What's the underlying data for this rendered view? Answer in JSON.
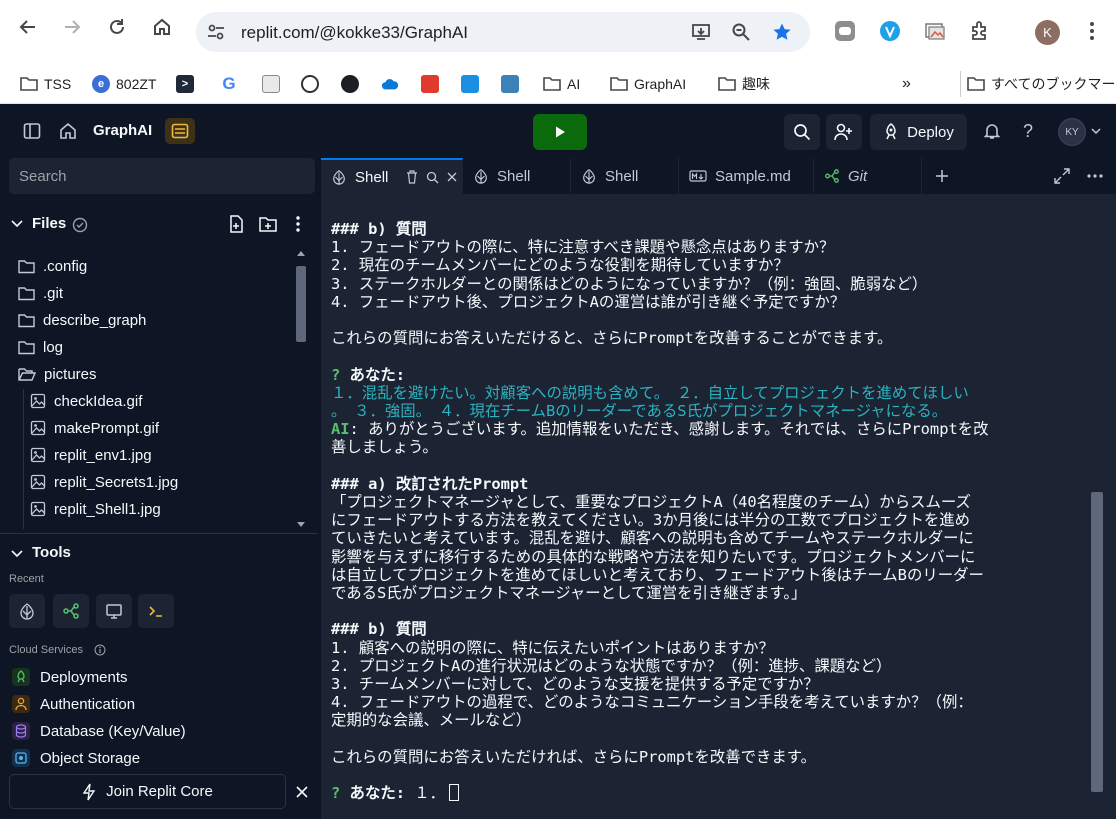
{
  "browser": {
    "url": "replit.com/@kokke33/GraphAI",
    "profile_initial": "K",
    "bookmarks": [
      {
        "label": "TSS",
        "icon": "folder-icon"
      },
      {
        "label": "802ZT",
        "icon": "globe-icon"
      },
      {
        "label": "",
        "icon": "terminal-icon"
      },
      {
        "label": "",
        "icon": "google-icon"
      },
      {
        "label": "",
        "icon": "image-icon"
      },
      {
        "label": "",
        "icon": "circle-icon"
      },
      {
        "label": "",
        "icon": "github-icon"
      },
      {
        "label": "",
        "icon": "cloud-icon"
      },
      {
        "label": "",
        "icon": "cube-icon"
      },
      {
        "label": "",
        "icon": "app-icon"
      },
      {
        "label": "",
        "icon": "list-icon"
      },
      {
        "label": "AI",
        "icon": "folder-icon"
      },
      {
        "label": "GraphAI",
        "icon": "folder-icon"
      },
      {
        "label": "趣味",
        "icon": "folder-icon"
      }
    ],
    "all_bookmarks": "すべてのブックマーク"
  },
  "header": {
    "repl_name": "GraphAI",
    "deploy_label": "Deploy",
    "user_initials": "KY"
  },
  "sidebar": {
    "search_placeholder": "Search",
    "files_title": "Files",
    "tree": [
      {
        "name": ".config",
        "type": "folder",
        "depth": 0
      },
      {
        "name": ".git",
        "type": "folder",
        "depth": 0
      },
      {
        "name": "describe_graph",
        "type": "folder",
        "depth": 0
      },
      {
        "name": "log",
        "type": "folder",
        "depth": 0
      },
      {
        "name": "pictures",
        "type": "folder-open",
        "depth": 0
      },
      {
        "name": "checkIdea.gif",
        "type": "image",
        "depth": 1
      },
      {
        "name": "makePrompt.gif",
        "type": "image",
        "depth": 1
      },
      {
        "name": "replit_env1.jpg",
        "type": "image",
        "depth": 1
      },
      {
        "name": "replit_Secrets1.jpg",
        "type": "image",
        "depth": 1
      },
      {
        "name": "replit_Shell1.jpg",
        "type": "image",
        "depth": 1
      }
    ],
    "tools_title": "Tools",
    "recent_label": "Recent",
    "cloud_label": "Cloud Services",
    "services": [
      {
        "label": "Deployments",
        "icon": "deploy-icon",
        "color": "#58c06b"
      },
      {
        "label": "Authentication",
        "icon": "user-icon",
        "color": "#f0a33a"
      },
      {
        "label": "Database (Key/Value)",
        "icon": "database-icon",
        "color": "#9d7bf0"
      },
      {
        "label": "Object Storage",
        "icon": "storage-icon",
        "color": "#56b3f0"
      }
    ],
    "join_label": "Join Replit Core"
  },
  "tabs": [
    {
      "label": "Shell",
      "icon": "shell-icon",
      "active": true
    },
    {
      "label": "Shell",
      "icon": "shell-icon",
      "active": false
    },
    {
      "label": "Shell",
      "icon": "shell-icon",
      "active": false
    },
    {
      "label": "Sample.md",
      "icon": "markdown-icon",
      "active": false
    },
    {
      "label": "Git",
      "icon": "git-icon",
      "active": false
    }
  ],
  "terminal": {
    "lines": [
      {
        "text": "### b) 質問",
        "style": "bold"
      },
      {
        "text": "1. フェードアウトの際に、特に注意すべき課題や懸念点はありますか？",
        "style": "normal"
      },
      {
        "text": "2. 現在のチームメンバーにどのような役割を期待していますか？",
        "style": "normal"
      },
      {
        "text": "3. ステークホルダーとの関係はどのようになっていますか？（例：強固、脆弱など）",
        "style": "normal"
      },
      {
        "text": "4. フェードアウト後、プロジェクトAの運営は誰が引き継ぐ予定ですか？",
        "style": "normal"
      },
      {
        "text": "",
        "style": "blank"
      },
      {
        "text": "これらの質問にお答えいただけると、さらにPromptを改善することができます。",
        "style": "normal"
      },
      {
        "text": "",
        "style": "blank"
      },
      {
        "prefix": "? ",
        "text": "あなた:",
        "style": "prompt"
      },
      {
        "text": "１．混乱を避けたい。対顧客への説明も含めて。　２．自立してプロジェクトを進めてほしい",
        "style": "teal"
      },
      {
        "text": "。　３．強固。　４．現在チームBのリーダーであるS氏がプロジェクトマネージャになる。",
        "style": "teal"
      },
      {
        "prefix": "AI",
        "text": ": ありがとうございます。追加情報をいただき、感謝します。それでは、さらにPromptを改",
        "style": "ai"
      },
      {
        "text": "善しましょう。",
        "style": "normal"
      },
      {
        "text": "",
        "style": "blank"
      },
      {
        "text": "### a) 改訂されたPrompt",
        "style": "bold"
      },
      {
        "text": "「プロジェクトマネージャとして、重要なプロジェクトA（40名程度のチーム）からスムーズ",
        "style": "normal"
      },
      {
        "text": "にフェードアウトする方法を教えてください。3か月後には半分の工数でプロジェクトを進め",
        "style": "normal"
      },
      {
        "text": "ていきたいと考えています。混乱を避け、顧客への説明も含めてチームやステークホルダーに",
        "style": "normal"
      },
      {
        "text": "影響を与えずに移行するための具体的な戦略や方法を知りたいです。プロジェクトメンバーに",
        "style": "normal"
      },
      {
        "text": "は自立してプロジェクトを進めてほしいと考えており、フェードアウト後はチームBのリーダー",
        "style": "normal"
      },
      {
        "text": "であるS氏がプロジェクトマネージャーとして運営を引き継ぎます。」",
        "style": "normal"
      },
      {
        "text": "",
        "style": "blank"
      },
      {
        "text": "### b) 質問",
        "style": "bold"
      },
      {
        "text": "1. 顧客への説明の際に、特に伝えたいポイントはありますか？",
        "style": "normal"
      },
      {
        "text": "2. プロジェクトAの進行状況はどのような状態ですか？（例：進捗、課題など）",
        "style": "normal"
      },
      {
        "text": "3. チームメンバーに対して、どのような支援を提供する予定ですか？",
        "style": "normal"
      },
      {
        "text": "4. フェードアウトの過程で、どのようなコミュニケーション手段を考えていますか？（例：",
        "style": "normal"
      },
      {
        "text": "定期的な会議、メールなど）",
        "style": "normal"
      },
      {
        "text": "",
        "style": "blank"
      },
      {
        "text": "これらの質問にお答えいただければ、さらにPromptを改善できます。",
        "style": "normal"
      },
      {
        "text": "",
        "style": "blank"
      },
      {
        "prefix": "? ",
        "text": "あなた:",
        "input": " １．",
        "style": "prompt-input"
      }
    ]
  }
}
